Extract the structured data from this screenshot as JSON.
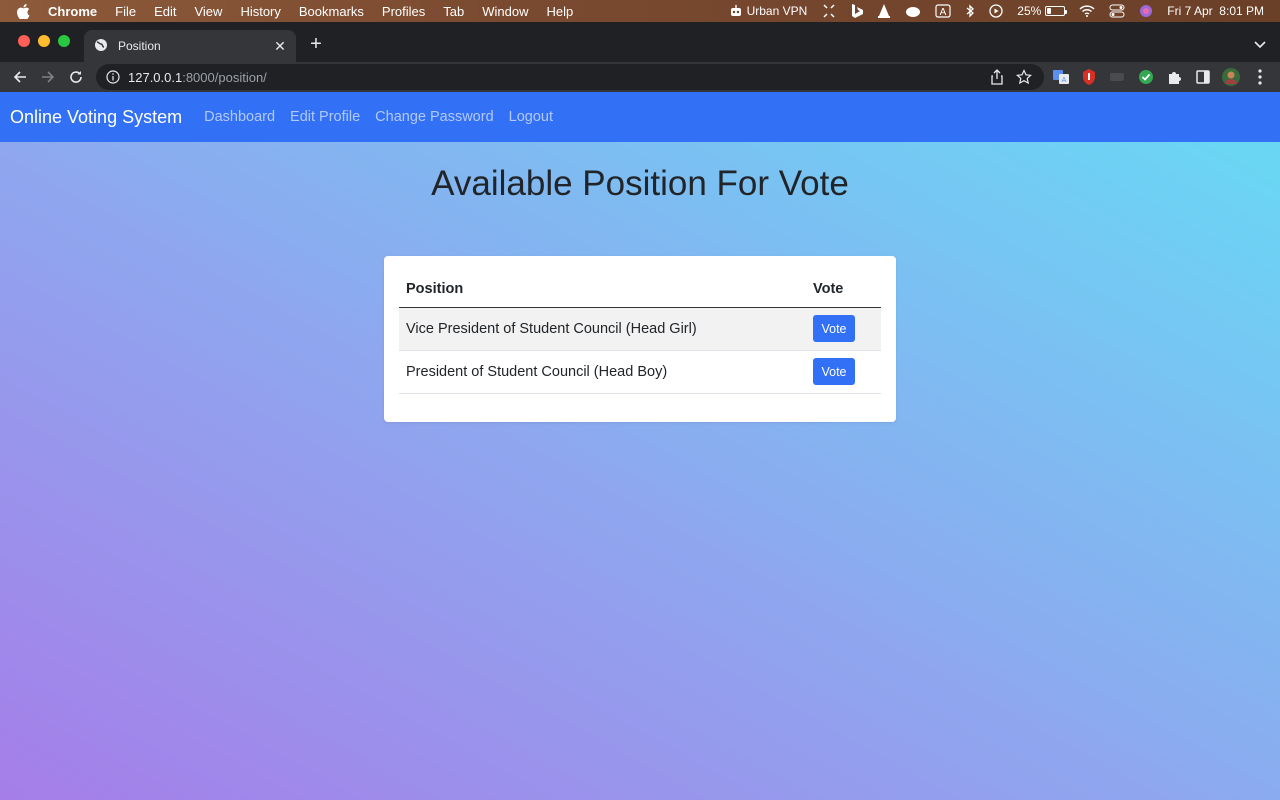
{
  "menubar": {
    "app": "Chrome",
    "items": [
      "File",
      "Edit",
      "View",
      "History",
      "Bookmarks",
      "Profiles",
      "Tab",
      "Window",
      "Help"
    ],
    "vpn": "Urban VPN",
    "battery_percent": "25%",
    "battery_level": 0.25,
    "datetime": "Fri 7 Apr  8:01 PM"
  },
  "browser": {
    "tab_title": "Position",
    "url_host": "127.0.0.1",
    "url_path": ":8000/position/"
  },
  "navbar": {
    "brand": "Online Voting System",
    "links": [
      "Dashboard",
      "Edit Profile",
      "Change Password",
      "Logout"
    ]
  },
  "main": {
    "heading": "Available Position For Vote",
    "table": {
      "headers": [
        "Position",
        "Vote"
      ],
      "rows": [
        {
          "position": "Vice President of Student Council (Head Girl)",
          "action": "Vote"
        },
        {
          "position": "President of Student Council (Head Boy)",
          "action": "Vote"
        }
      ]
    }
  },
  "colors": {
    "navbar": "#3270f5",
    "button": "#3270f5"
  }
}
